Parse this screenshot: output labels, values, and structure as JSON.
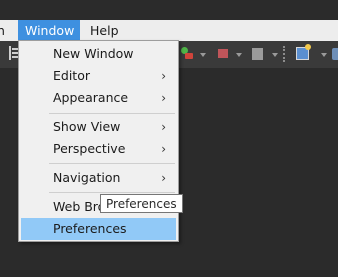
{
  "menubar": {
    "prev_item": "n",
    "window": "Window",
    "help": "Help"
  },
  "window_menu": {
    "items": [
      {
        "label": "New Window",
        "arrow": ""
      },
      {
        "label": "Editor",
        "arrow": "›"
      },
      {
        "label": "Appearance",
        "arrow": "›"
      },
      {
        "label": "Show View",
        "arrow": "›"
      },
      {
        "label": "Perspective",
        "arrow": "›"
      },
      {
        "label": "Navigation",
        "arrow": "›"
      },
      {
        "label": "Web Bro",
        "arrow": ""
      },
      {
        "label": "Preferences",
        "arrow": "",
        "highlighted": true
      }
    ]
  },
  "tooltip": {
    "text": "Preferences"
  },
  "colors": {
    "menu_highlight": "#91c9f7",
    "menubar_active": "#3e90e0",
    "background": "#2b2b2b"
  }
}
